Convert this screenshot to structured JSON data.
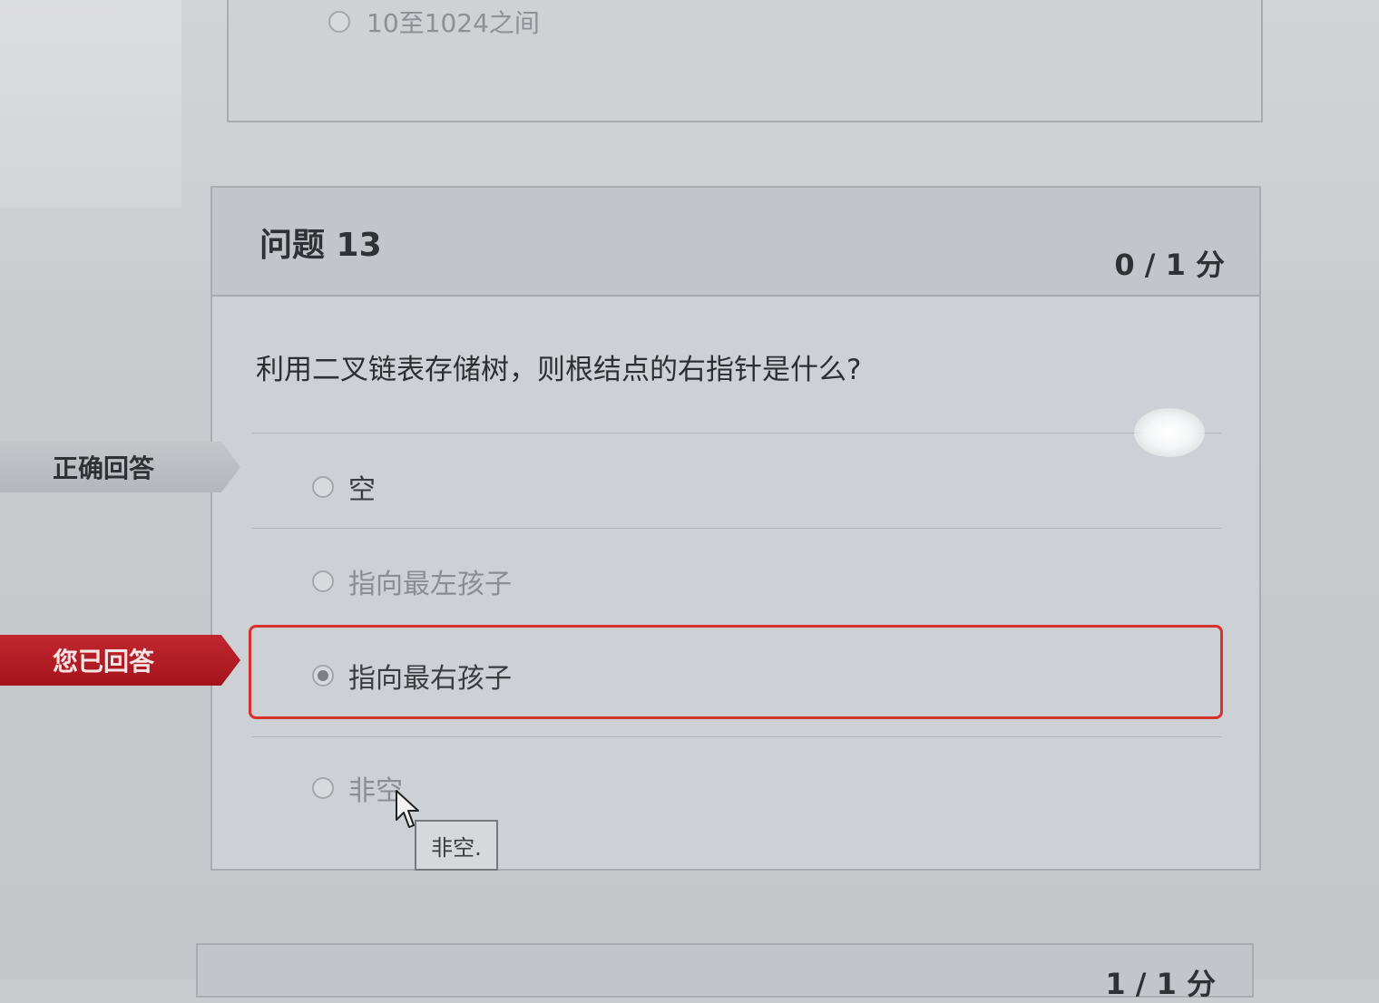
{
  "previous_question": {
    "last_option": "10至1024之间"
  },
  "question": {
    "title": "问题 13",
    "score": "0 / 1 分",
    "text": "利用二叉链表存储树，则根结点的右指针是什么?",
    "options": [
      {
        "label": "空",
        "selected": false,
        "correct": true
      },
      {
        "label": "指向最左孩子",
        "selected": false,
        "correct": false
      },
      {
        "label": "指向最右孩子",
        "selected": true,
        "correct": false
      },
      {
        "label": "非空",
        "selected": false,
        "correct": false
      }
    ]
  },
  "tags": {
    "correct": "正确回答",
    "yours": "您已回答"
  },
  "tooltip": {
    "text": "非空."
  },
  "next_question": {
    "score": "1 / 1 分"
  },
  "colors": {
    "answered_border": "#d8322c",
    "your_answer_tag": "#b41b24"
  },
  "icons": {
    "cursor": "mouse-pointer-icon",
    "radio": "radio-button-icon"
  }
}
